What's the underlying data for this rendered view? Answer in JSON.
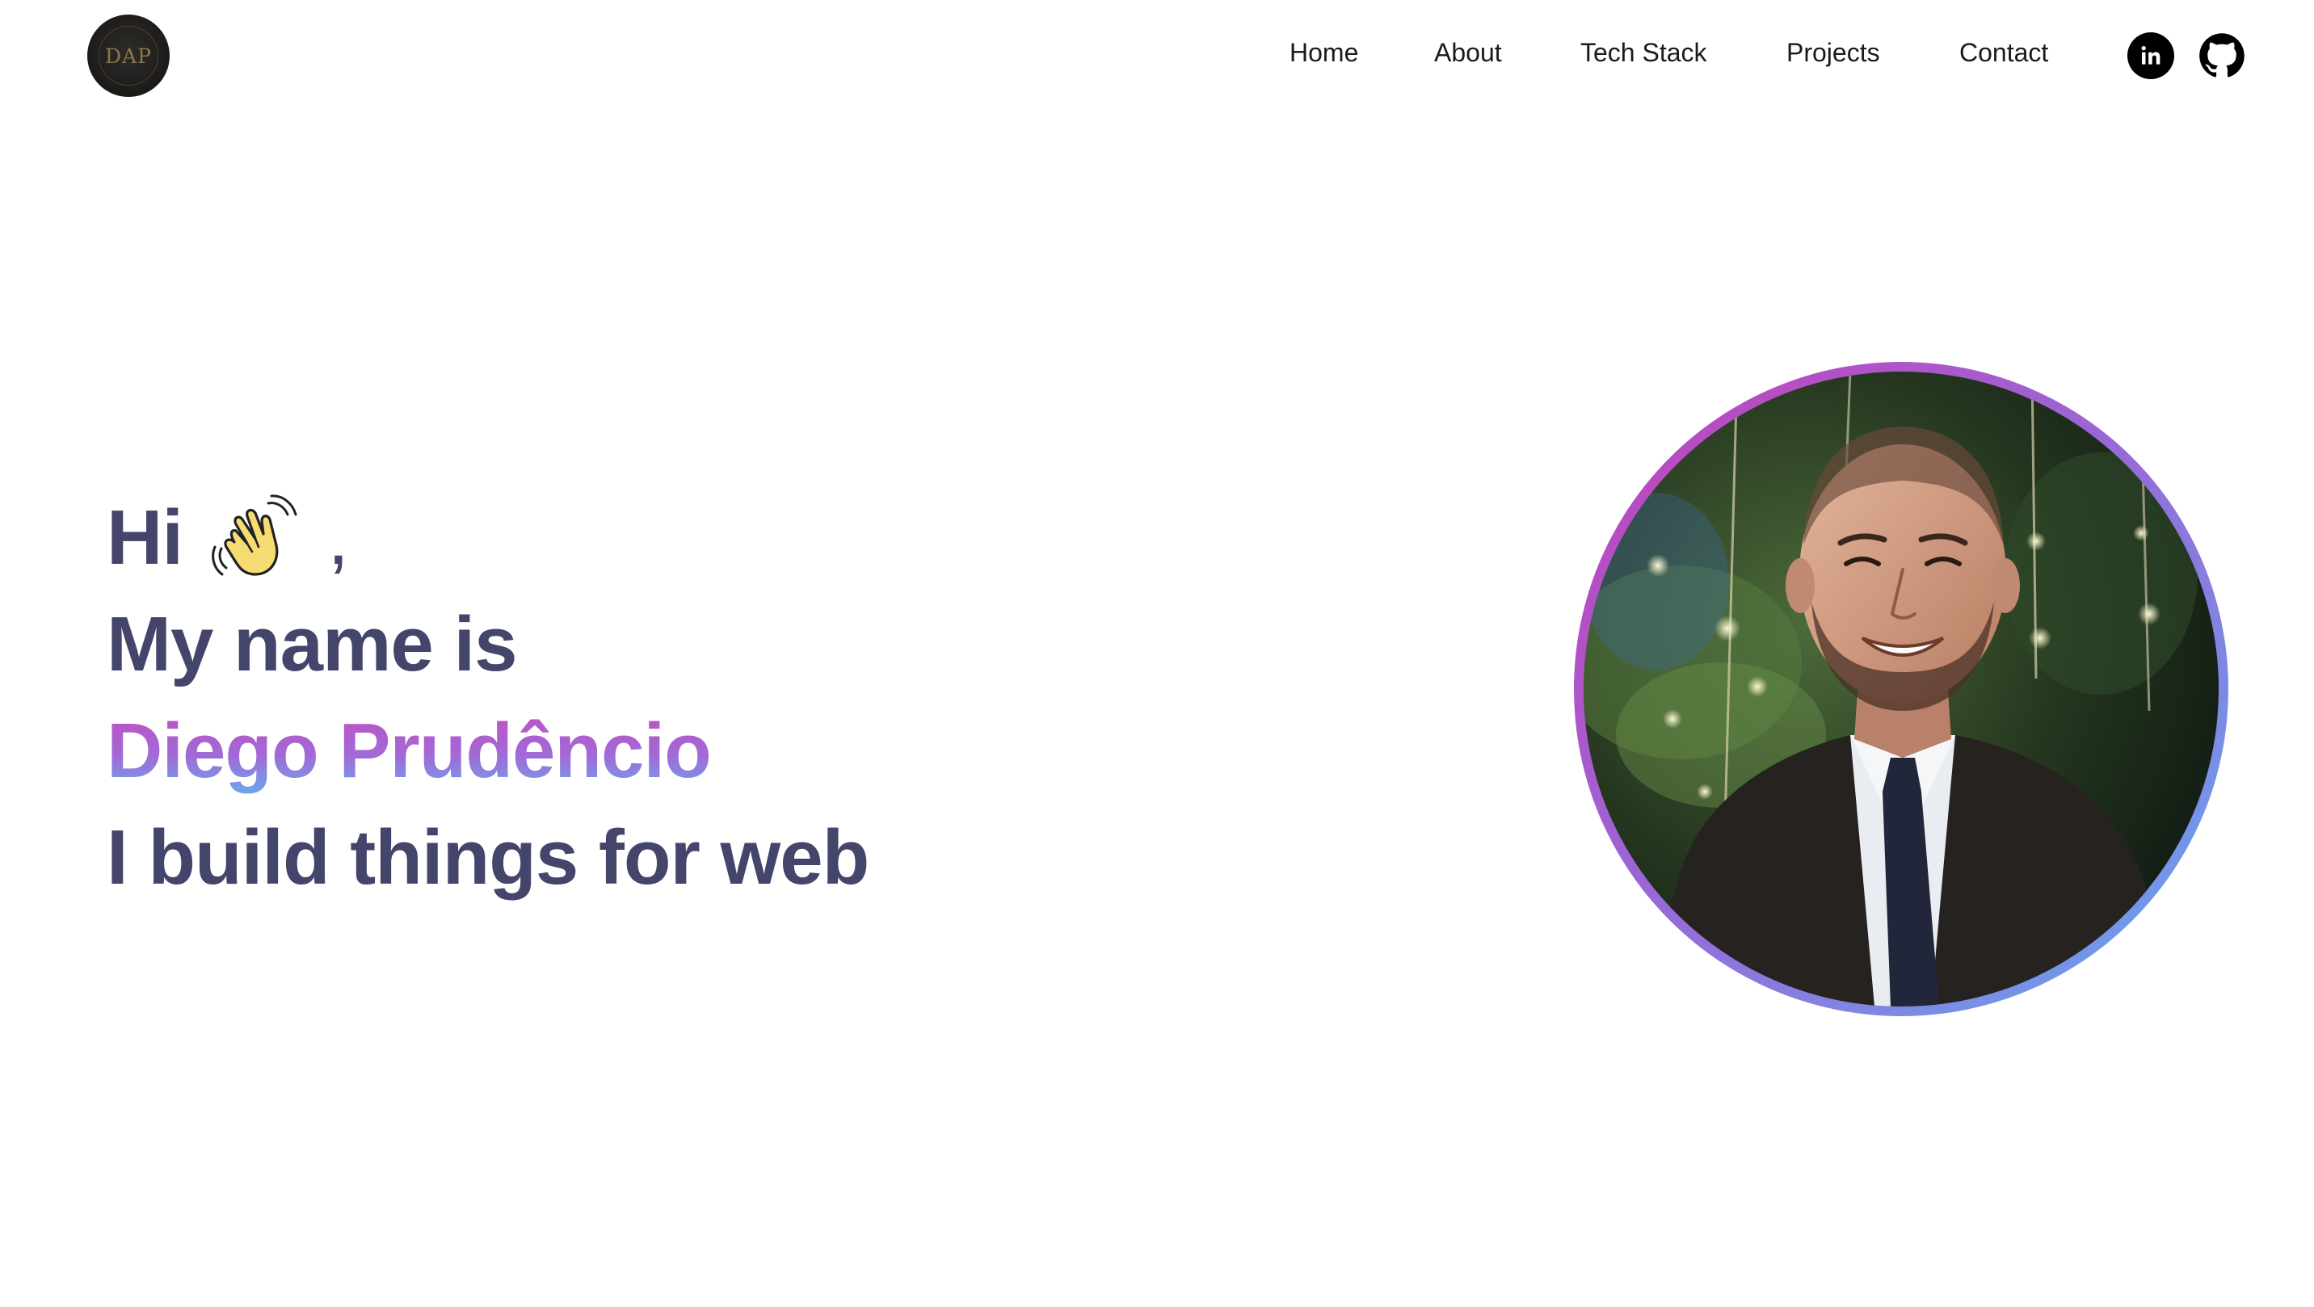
{
  "header": {
    "logo_text": "DAP",
    "nav": [
      {
        "label": "Home"
      },
      {
        "label": "About"
      },
      {
        "label": "Tech Stack"
      },
      {
        "label": "Projects"
      },
      {
        "label": "Contact"
      }
    ],
    "social": [
      {
        "icon": "linkedin-icon"
      },
      {
        "icon": "github-icon"
      }
    ]
  },
  "hero": {
    "greeting": "Hi",
    "greeting_suffix": ",",
    "intro": "My name is",
    "name": "Diego Prudêncio",
    "tagline": "I build things for web",
    "wave_icon": "waving-hand-icon"
  },
  "portrait": {
    "alt": "Diego Prudêncio"
  },
  "colors": {
    "heading": "#44456b",
    "gradient_start": "#c24ec1",
    "gradient_end": "#6aa7ec",
    "nav_text": "#1b1b1b"
  }
}
